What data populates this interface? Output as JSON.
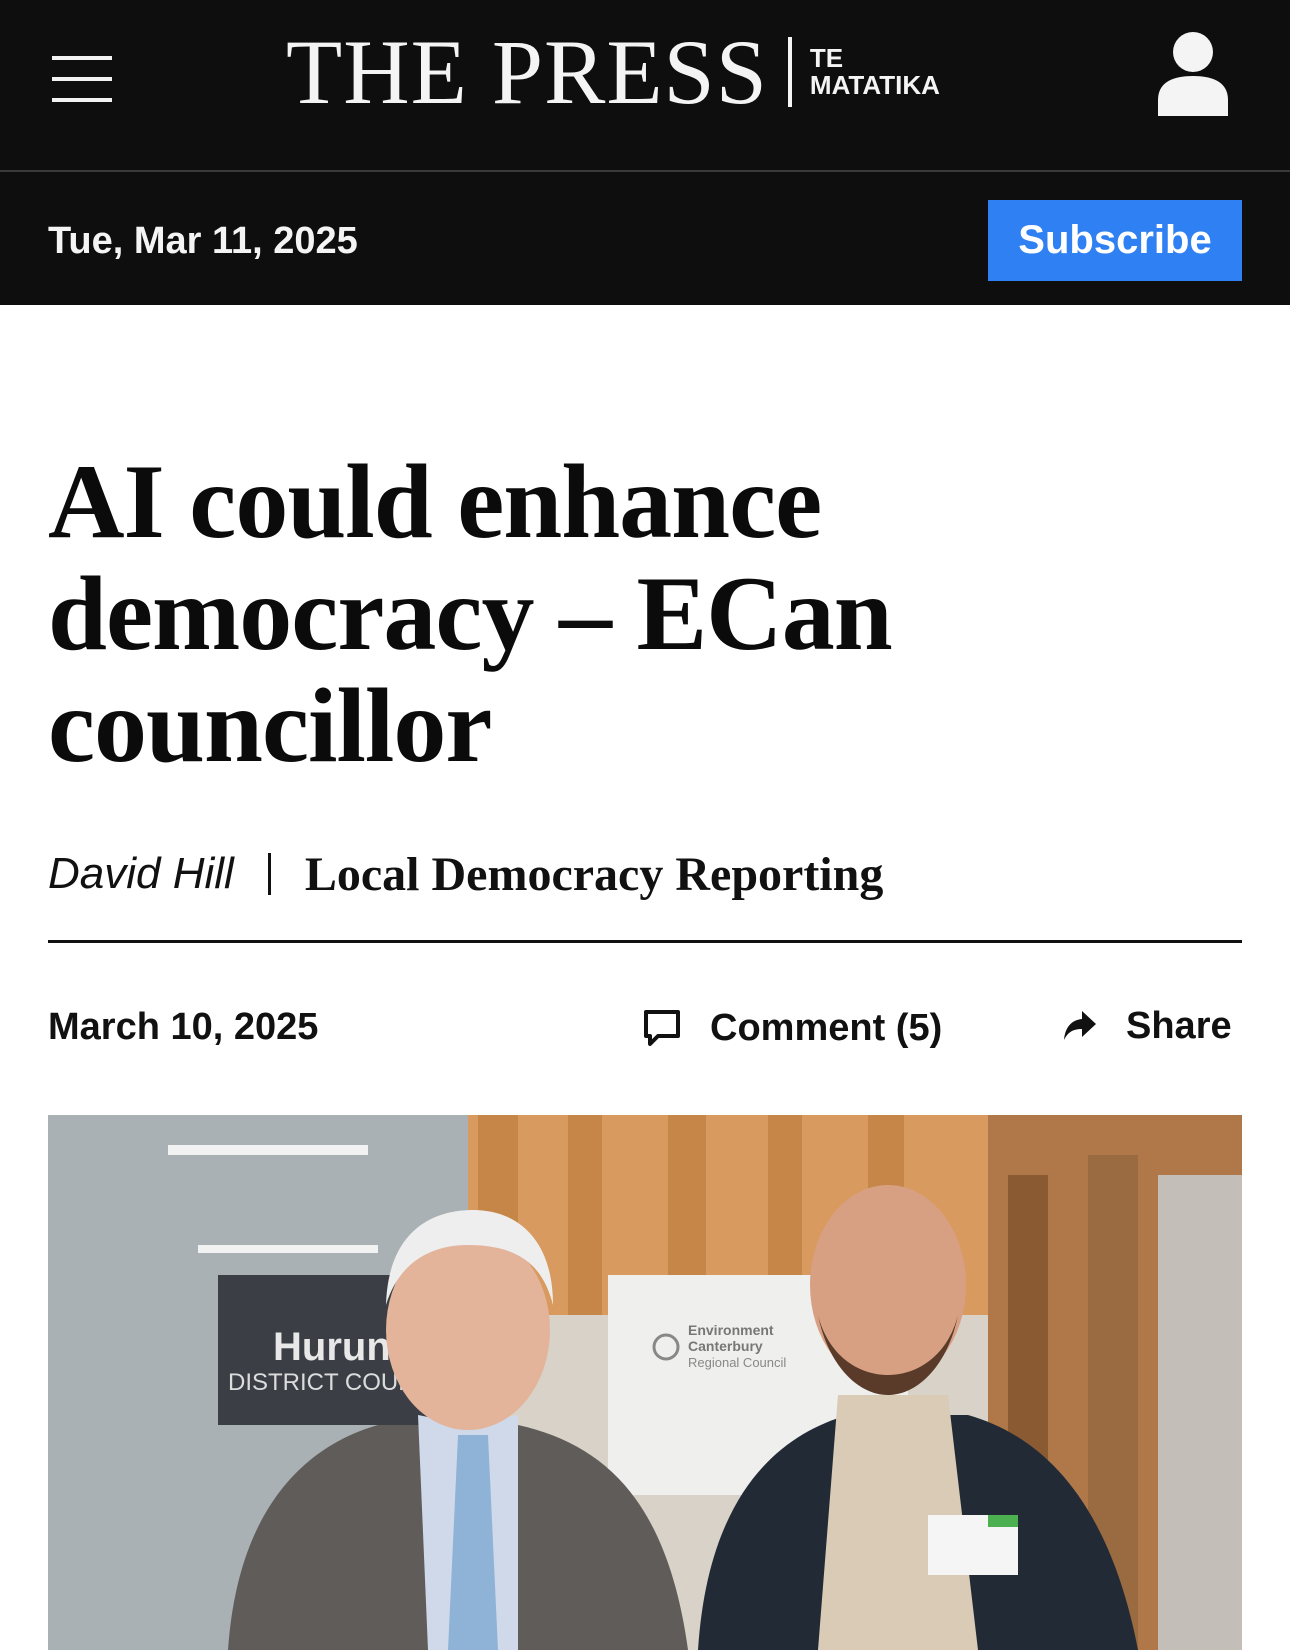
{
  "header": {
    "menu_icon": "hamburger-menu-icon",
    "masthead_name": "THE PRESS",
    "masthead_sub_line1": "TE",
    "masthead_sub_line2": "MATATIKA",
    "account_icon": "user-account-icon"
  },
  "datebar": {
    "today": "Tue, Mar 11, 2025",
    "subscribe_label": "Subscribe",
    "subscribe_color": "#2f80f2"
  },
  "article": {
    "headline": "AI could enhance democracy – ECan councillor",
    "author": "David Hill",
    "source": "Local Democracy Reporting",
    "published": "March 10, 2025",
    "comment_label": "Comment (5)",
    "share_label": "Share"
  },
  "photo": {
    "sign_line1": "Hurun",
    "sign_line2": "DISTRICT COUN",
    "banner_line1": "Environment",
    "banner_line2": "Canterbury",
    "banner_line3": "Regional Council"
  }
}
